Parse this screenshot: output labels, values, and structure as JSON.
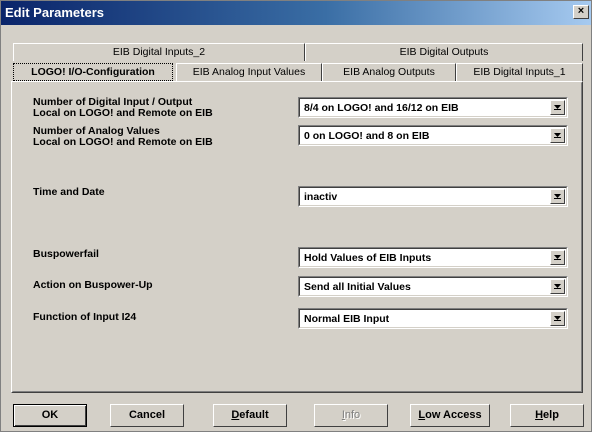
{
  "window": {
    "title": "Edit Parameters",
    "close_glyph": "×"
  },
  "tabs_back": [
    {
      "label": "EIB Digital Inputs_2"
    },
    {
      "label": "EIB Digital Outputs"
    }
  ],
  "tabs_front": [
    {
      "label": "LOGO! I/O-Configuration",
      "active": true
    },
    {
      "label": "EIB Analog Input Values"
    },
    {
      "label": "EIB Analog Outputs"
    },
    {
      "label": "EIB Digital Inputs_1"
    }
  ],
  "params": {
    "digital_io": {
      "label_line1": "Number of Digital Input / Output",
      "label_line2": "Local on LOGO! and Remote on EIB",
      "value": "8/4 on LOGO! and 16/12 on EIB"
    },
    "analog_values": {
      "label_line1": "Number of Analog Values",
      "label_line2": "Local on LOGO! and Remote on EIB",
      "value": "0 on LOGO! and 8 on EIB"
    },
    "time_date": {
      "label": "Time and Date",
      "value": "inactiv"
    },
    "buspowerfail": {
      "label": "Buspowerfail",
      "value": "Hold Values of EIB Inputs"
    },
    "buspower_up": {
      "label": "Action on Buspower-Up",
      "value": "Send all Initial Values"
    },
    "input_i24": {
      "label": "Function of Input I24",
      "value": "Normal EIB Input"
    }
  },
  "buttons": {
    "ok": "OK",
    "cancel": "Cancel",
    "default_first": "D",
    "default_rest": "efault",
    "info_first": "I",
    "info_rest": "nfo",
    "low_first": "L",
    "low_rest": "ow Access",
    "help_first": "H",
    "help_rest": "elp"
  }
}
